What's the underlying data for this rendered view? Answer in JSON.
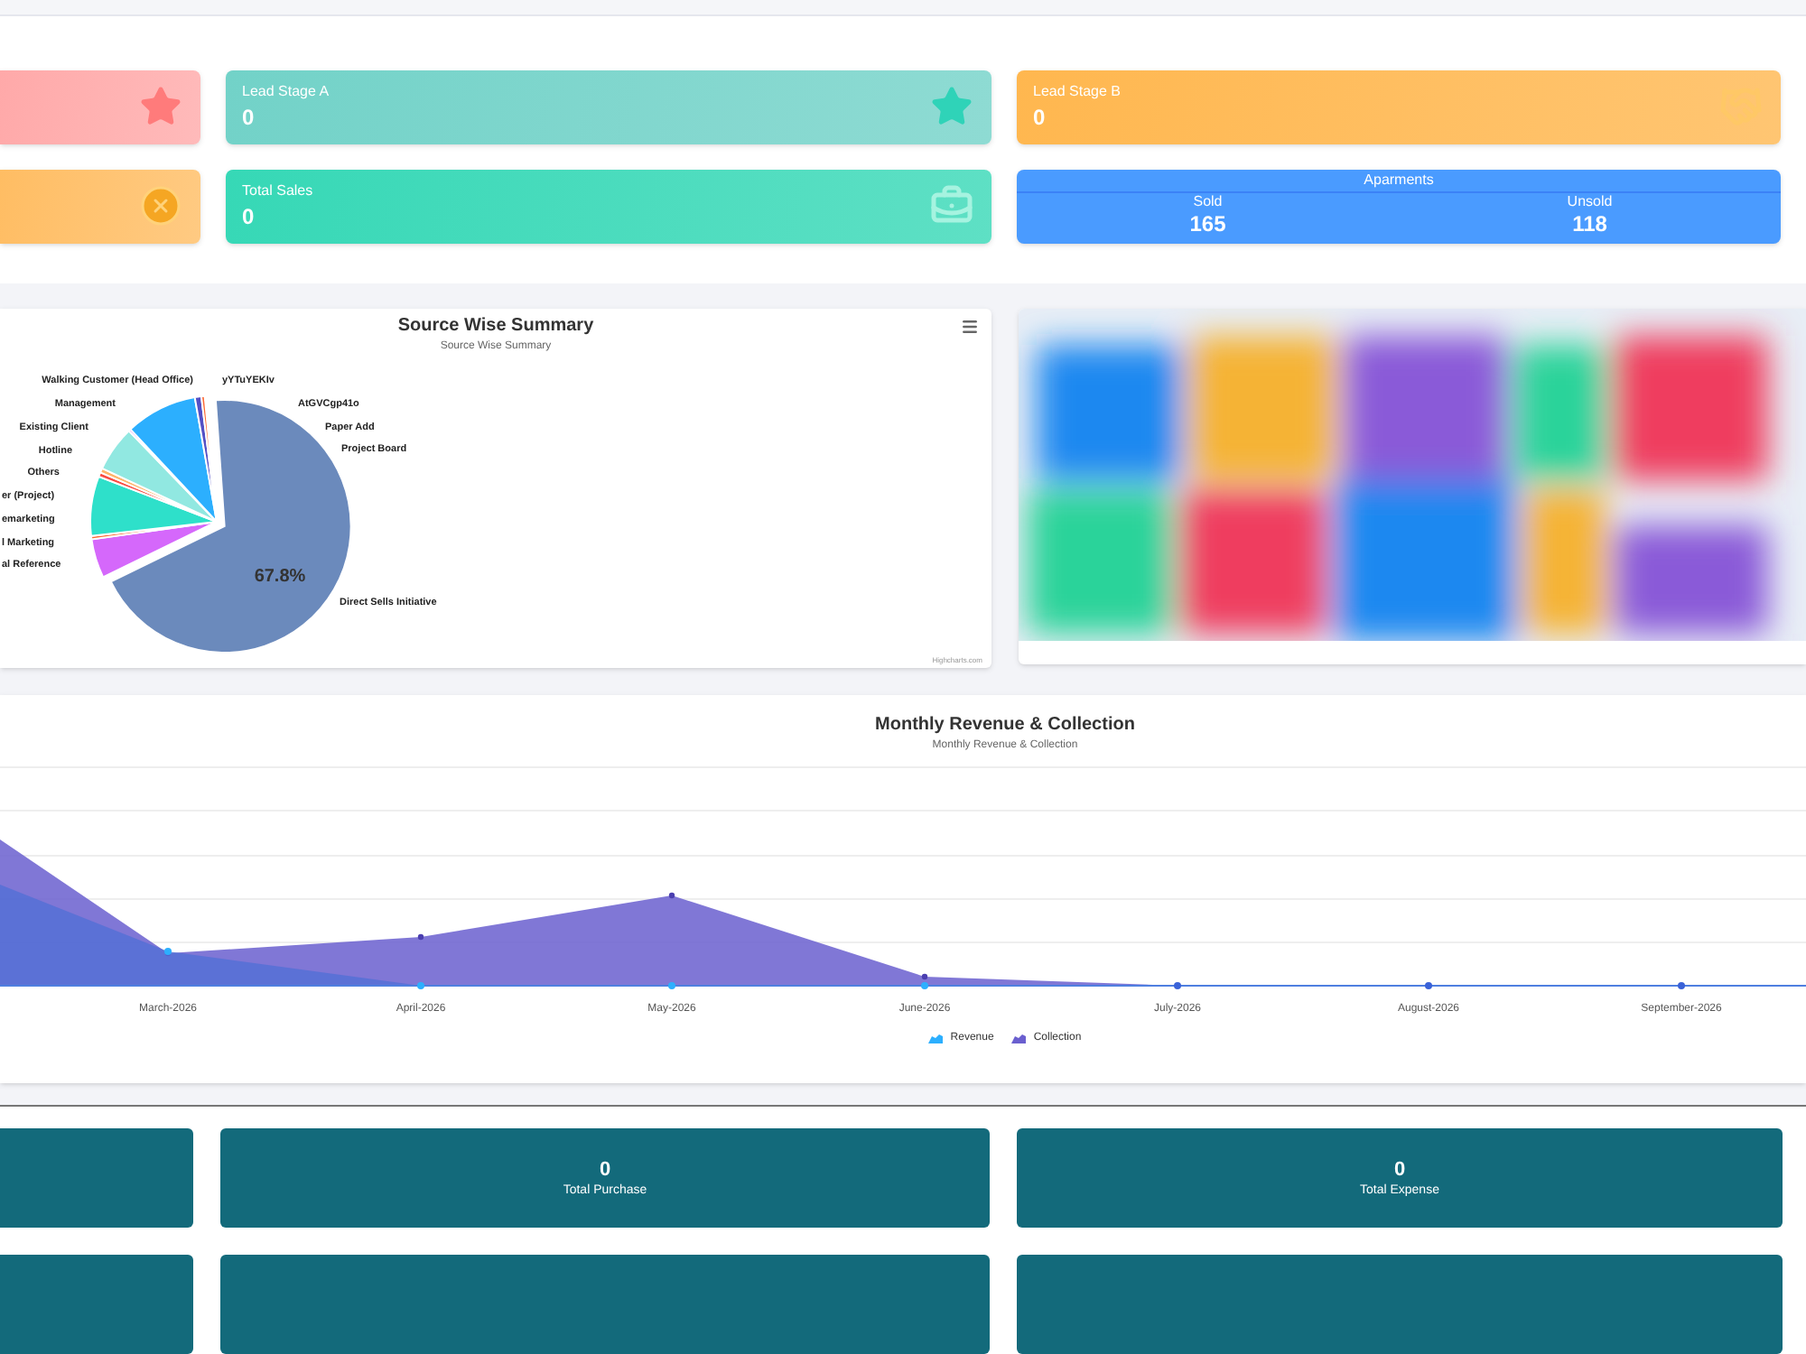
{
  "stat_cards": [
    {
      "kind": "plain",
      "color": "#ffa9a9"
    },
    {
      "kind": "stat",
      "label": "Lead Stage A",
      "value": "0",
      "color": "#72d2c8"
    },
    {
      "kind": "stat",
      "label": "Lead Stage B",
      "value": "0",
      "color": "#ffb74f"
    },
    {
      "kind": "plain",
      "color": "#ffbd63"
    },
    {
      "kind": "stat",
      "label": "Total Sales",
      "value": "0",
      "color": "#36d8b6"
    },
    {
      "kind": "split",
      "label": "Aparments",
      "color": "#4a9bff",
      "items": [
        {
          "label": "Sold",
          "value": "165"
        },
        {
          "label": "Unsold",
          "value": "118"
        }
      ]
    }
  ],
  "source_chart": {
    "title": "Source Wise Summary",
    "subtitle": "Source Wise Summary",
    "value_label": "67.8%",
    "credit": "Highcharts.com",
    "slice_labels": [
      "Walking Customer (Head Office)",
      "yYTuYEKIv",
      "Management",
      "AtGVCgp41o",
      "Existing Client",
      "Paper Add",
      "Hotline",
      "Project Board",
      "Others",
      "er (Project)",
      "emarketing",
      "l Marketing",
      "al Reference",
      "Direct Sells Initiative"
    ]
  },
  "revenue_chart": {
    "title": "Monthly Revenue & Collection",
    "subtitle": "Monthly Revenue & Collection",
    "x_labels": [
      "March-2026",
      "April-2026",
      "May-2026",
      "June-2026",
      "July-2026",
      "August-2026",
      "September-2026"
    ],
    "legend": [
      {
        "name": "Revenue",
        "color": "#2caffe"
      },
      {
        "name": "Collection",
        "color": "#6a5fcf"
      }
    ]
  },
  "bottom_cards": [
    {
      "kind": "blank"
    },
    {
      "kind": "stat",
      "value": "0",
      "label": "Total Purchase"
    },
    {
      "kind": "stat",
      "value": "0",
      "label": "Total Expense"
    },
    {
      "kind": "blank"
    },
    {
      "kind": "blank"
    },
    {
      "kind": "blank"
    }
  ]
}
